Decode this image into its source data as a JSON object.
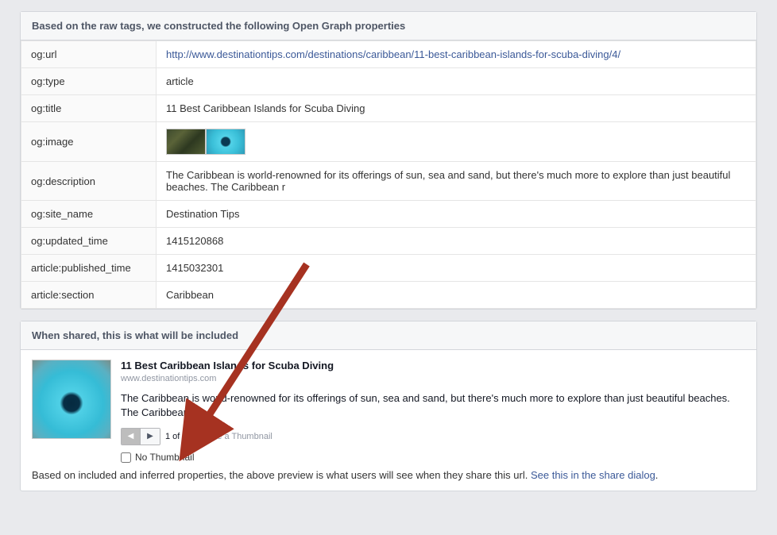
{
  "section1": {
    "header": "Based on the raw tags, we constructed the following Open Graph properties",
    "rows": [
      {
        "key": "og:url",
        "value": "http://www.destinationtips.com/destinations/caribbean/11-best-caribbean-islands-for-scuba-diving/4/",
        "isLink": true
      },
      {
        "key": "og:type",
        "value": "article"
      },
      {
        "key": "og:title",
        "value": "11 Best Caribbean Islands for Scuba Diving"
      },
      {
        "key": "og:image",
        "value": "",
        "isImage": true
      },
      {
        "key": "og:description",
        "value": "The Caribbean is world-renowned for its offerings of sun, sea and sand, but there's much more to explore than just beautiful beaches. The Caribbean r"
      },
      {
        "key": "og:site_name",
        "value": "Destination Tips"
      },
      {
        "key": "og:updated_time",
        "value": "1415120868"
      },
      {
        "key": "article:published_time",
        "value": "1415032301"
      },
      {
        "key": "article:section",
        "value": "Caribbean"
      }
    ]
  },
  "section2": {
    "header": "When shared, this is what will be included",
    "preview": {
      "title": "11 Best Caribbean Islands for Scuba Diving",
      "domain": "www.destinationtips.com",
      "description": "The Caribbean is world-renowned for its offerings of sun, sea and sand, but there's much more to explore than just beautiful beaches. The Caribbean r",
      "counter": "1 of 2",
      "choose": "Choose a Thumbnail",
      "noThumb": "No Thumbnail"
    },
    "footer": {
      "prefix": "Based on included and inferred properties, the above preview is what users will see when they share this url. ",
      "link": "See this in the share dialog",
      "suffix": "."
    }
  }
}
